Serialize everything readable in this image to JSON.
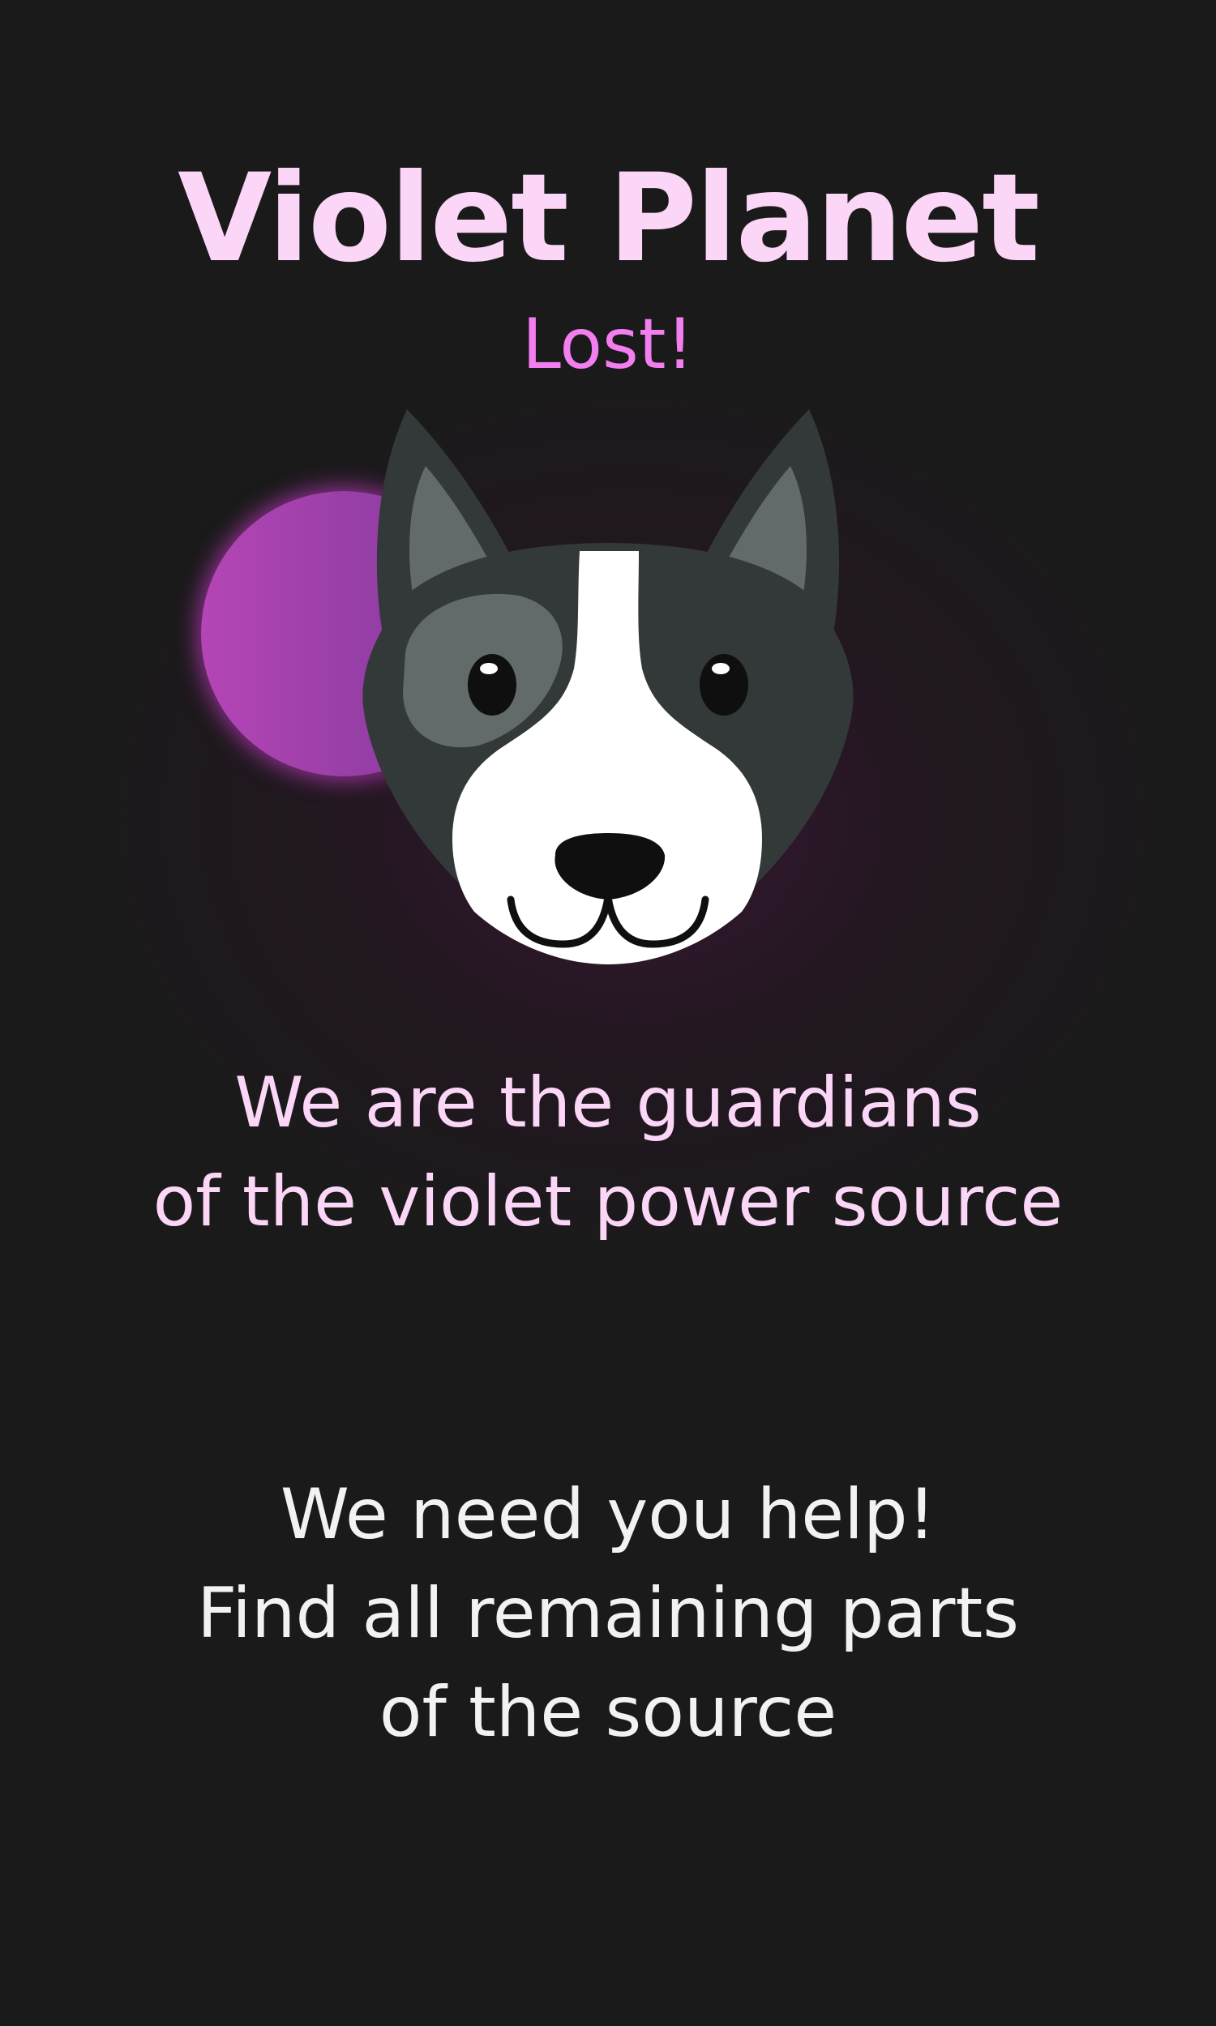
{
  "game": {
    "title": "Violet Planet",
    "status": "Lost!",
    "message_1": "We are the guardians\nof the violet power source",
    "message_2": "We need you help!\nFind all remaining parts\nof the source"
  },
  "illustration": {
    "planet_icon": "violet-planet",
    "character_icon": "dog-face"
  },
  "colors": {
    "background": "#1a1a1a",
    "title": "#fbd6f7",
    "status": "#f27ef0",
    "message_primary": "#fbd6f7",
    "message_secondary": "#f2f2f2",
    "planet": "#a040b0"
  }
}
